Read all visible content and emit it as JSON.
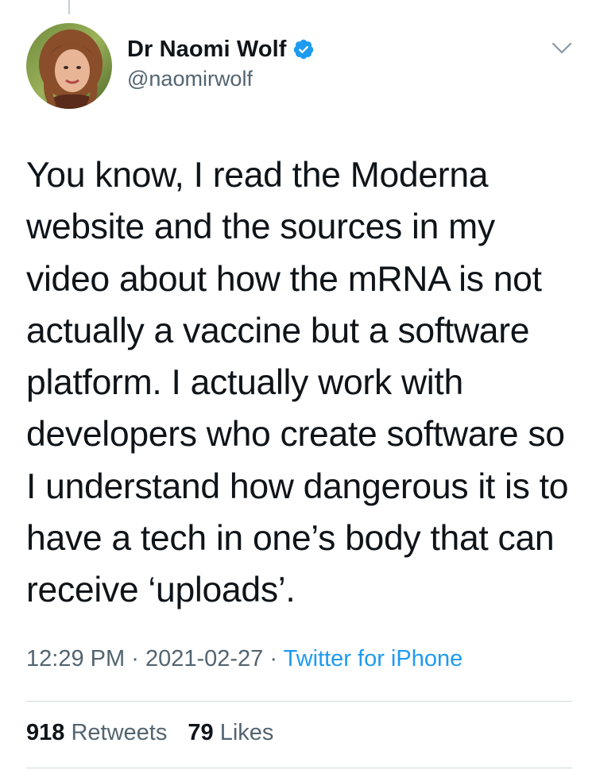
{
  "tweet": {
    "author": {
      "display_name": "Dr Naomi Wolf",
      "handle": "@naomirwolf",
      "verified": true,
      "avatar_icon": "profile-photo"
    },
    "text": "You know, I read the Moderna\nwebsite and the sources in my\nvideo about how the mRNA is not\nactually a vaccine but a software\nplatform. I actually work with\ndevelopers who create software so\nI understand how dangerous it is to\nhave a tech in one’s body that can\nreceive ‘uploads’.",
    "meta": {
      "time": "12:29 PM",
      "separator": "·",
      "date": "2021-02-27",
      "source": "Twitter for iPhone"
    },
    "stats": {
      "retweets_count": "918",
      "retweets_label": "Retweets",
      "likes_count": "79",
      "likes_label": "Likes"
    }
  },
  "colors": {
    "accent": "#1d9bf0",
    "secondary_text": "#536471",
    "primary_text": "#0f1419",
    "divider": "#cfd9de"
  }
}
